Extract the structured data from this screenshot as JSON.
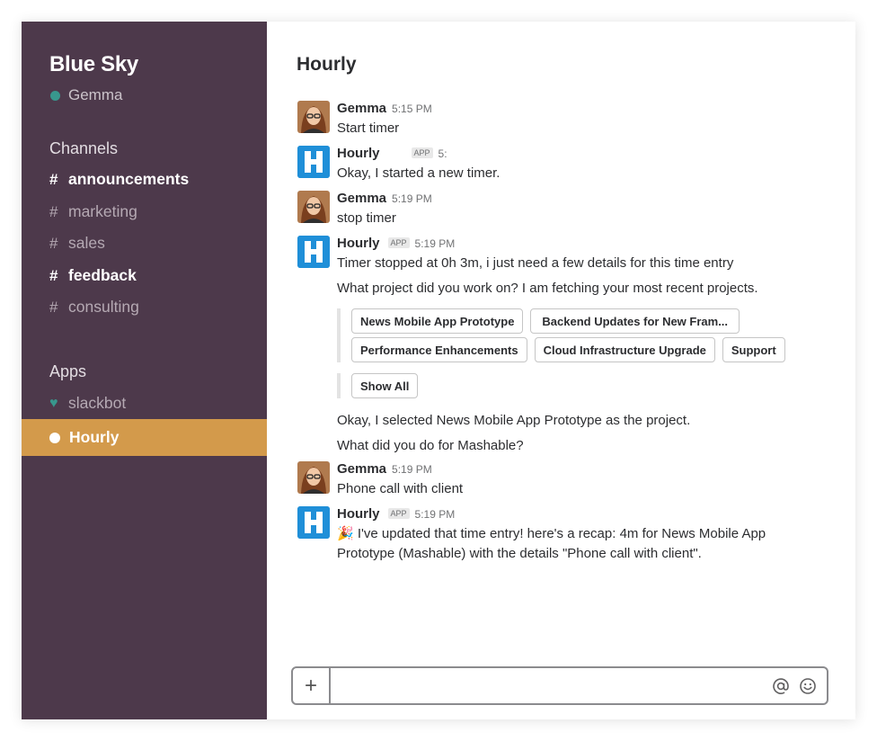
{
  "sidebar": {
    "team_name": "Blue Sky",
    "user_name": "Gemma",
    "channels_title": "Channels",
    "channels": [
      {
        "label": "announcements"
      },
      {
        "label": "marketing"
      },
      {
        "label": "sales"
      },
      {
        "label": "feedback"
      },
      {
        "label": "consulting"
      }
    ],
    "apps_title": "Apps",
    "apps": [
      {
        "label": "slackbot"
      },
      {
        "label": "Hourly"
      }
    ]
  },
  "main": {
    "channel_title": "Hourly",
    "messages": [
      {
        "author": "Gemma",
        "time": "5:15 PM",
        "lines": [
          "Start timer"
        ]
      },
      {
        "author": "Hourly",
        "badge": "APP",
        "time": "5:",
        "lines": [
          "Okay, I started a new timer."
        ]
      },
      {
        "author": "Gemma",
        "time": "5:19 PM",
        "lines": [
          "stop timer"
        ]
      },
      {
        "author": "Hourly",
        "badge": "APP",
        "time": "5:19 PM",
        "lines": [
          "Timer stopped at 0h 3m, i just need a few details for this time entry",
          "What project did you work on? I am fetching your most recent projects."
        ]
      },
      {
        "author": "Gemma",
        "time": "5:19 PM",
        "lines": [
          "Phone call with client"
        ]
      },
      {
        "author": "Hourly",
        "badge": "APP",
        "time": "5:19 PM",
        "lines": [
          "🎉 I've updated that time entry! here's a recap:  4m for News Mobile App",
          "Prototype (Mashable) with the details \"Phone call with client\"."
        ]
      }
    ],
    "project_buttons_row1": [
      "News Mobile App Prototype",
      "Backend Updates for New Fram..."
    ],
    "project_buttons_row2": [
      "Performance Enhancements",
      "Cloud Infrastructure Upgrade",
      "Support"
    ],
    "show_all": "Show All",
    "followups": [
      "Okay, I selected News Mobile App Prototype as the project.",
      "What did you do for Mashable?"
    ]
  },
  "composer": {
    "plus": "+",
    "placeholder": ""
  },
  "icons": {
    "at": "at-icon",
    "emoji": "emoji-icon",
    "plus": "plus-icon"
  },
  "colors": {
    "sidebar_bg": "#4d394b",
    "active_item": "#d39a4b",
    "presence": "#38978d",
    "hourly_brand": "#1f8fd8"
  }
}
